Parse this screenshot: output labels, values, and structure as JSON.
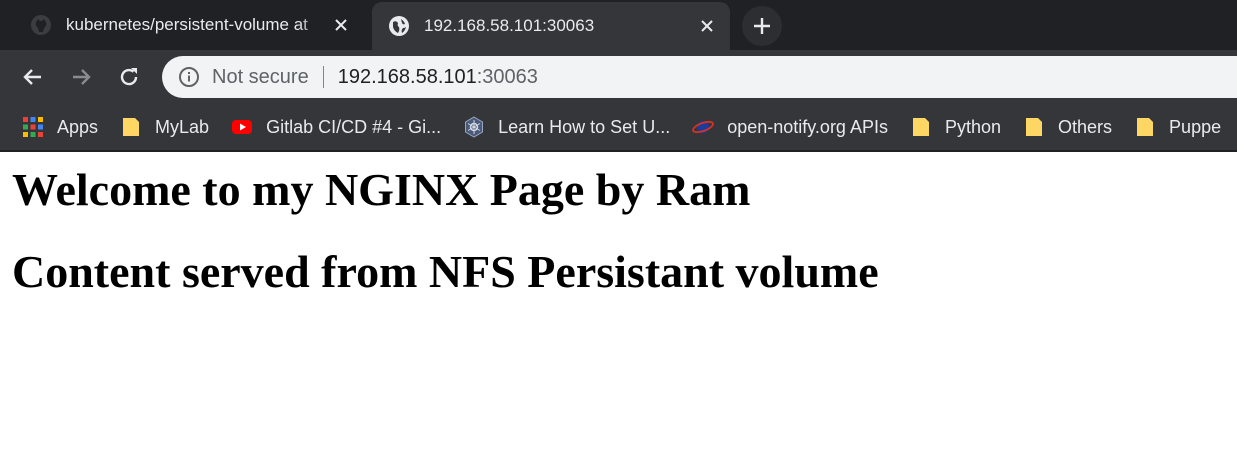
{
  "browser": {
    "tabs": [
      {
        "title": "kubernetes/persistent-volume at",
        "favicon": "github-icon",
        "active": false
      },
      {
        "title": "192.168.58.101:30063",
        "favicon": "globe-icon",
        "active": true
      }
    ],
    "new_tab_icon": "plus-icon",
    "nav": {
      "back_icon": "back-arrow-icon",
      "forward_icon": "forward-arrow-icon",
      "reload_icon": "reload-icon"
    },
    "address_bar": {
      "security_icon": "info-icon",
      "security_text": "Not secure",
      "host": "192.168.58.101",
      "port": ":30063"
    },
    "bookmarks": [
      {
        "label": "Apps",
        "icon": "apps-grid-icon"
      },
      {
        "label": "MyLab",
        "icon": "folder-icon"
      },
      {
        "label": "Gitlab CI/CD #4 - Gi...",
        "icon": "youtube-icon"
      },
      {
        "label": "Learn How to Set U...",
        "icon": "kubernetes-icon"
      },
      {
        "label": "open-notify.org APIs",
        "icon": "planet-icon"
      },
      {
        "label": "Python",
        "icon": "folder-icon"
      },
      {
        "label": "Others",
        "icon": "folder-icon"
      },
      {
        "label": "Puppe",
        "icon": "folder-icon"
      }
    ]
  },
  "page": {
    "heading1": "Welcome to my NGINX Page by Ram",
    "heading2": "Content served from NFS Persistant volume"
  },
  "colors": {
    "tabstrip": "#202124",
    "toolbar": "#35363a",
    "omnibox": "#f1f3f4",
    "folder": "#fdd663",
    "youtube": "#ff0000"
  }
}
